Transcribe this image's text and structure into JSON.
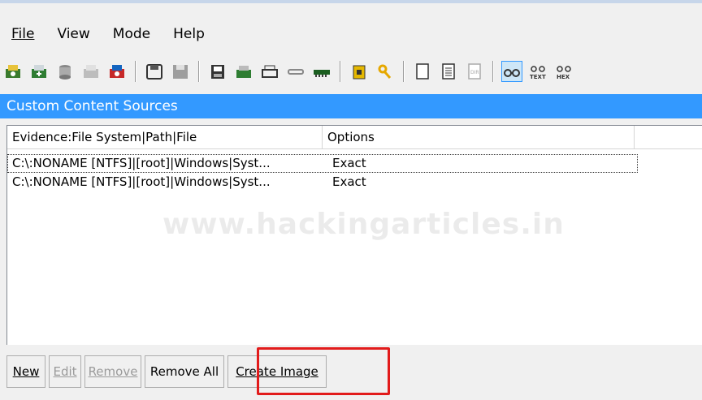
{
  "menu": {
    "items": [
      "File",
      "View",
      "Mode",
      "Help"
    ]
  },
  "toolbar": {
    "icons": [
      "add-evidence-icon",
      "add-image-icon",
      "acquire-icon",
      "remove-evidence-icon",
      "case-icon",
      "disk-icon",
      "save-icon",
      "export-icon",
      "report-icon",
      "print-icon",
      "link-icon",
      "memory-icon",
      "encrypt-icon",
      "key-icon",
      "blank-page-icon",
      "document-icon",
      "directory-icon",
      "view-icon",
      "text-view-icon",
      "hex-view-icon"
    ]
  },
  "panel": {
    "title": "Custom Content Sources"
  },
  "list": {
    "columns": [
      "Evidence:File System|Path|File",
      "Options"
    ],
    "rows": [
      {
        "path": "C:\\:NONAME [NTFS]|[root]|Windows|Syst...",
        "option": "Exact"
      },
      {
        "path": "C:\\:NONAME [NTFS]|[root]|Windows|Syst...",
        "option": "Exact"
      }
    ]
  },
  "watermark": "www.hackingarticles.in",
  "buttons": {
    "new": "New",
    "edit": "Edit",
    "remove": "Remove",
    "remove_all": "Remove All",
    "create_image": "Create Image"
  },
  "colors": {
    "title_bg": "#3399ff",
    "highlight": "#e21b1b"
  }
}
